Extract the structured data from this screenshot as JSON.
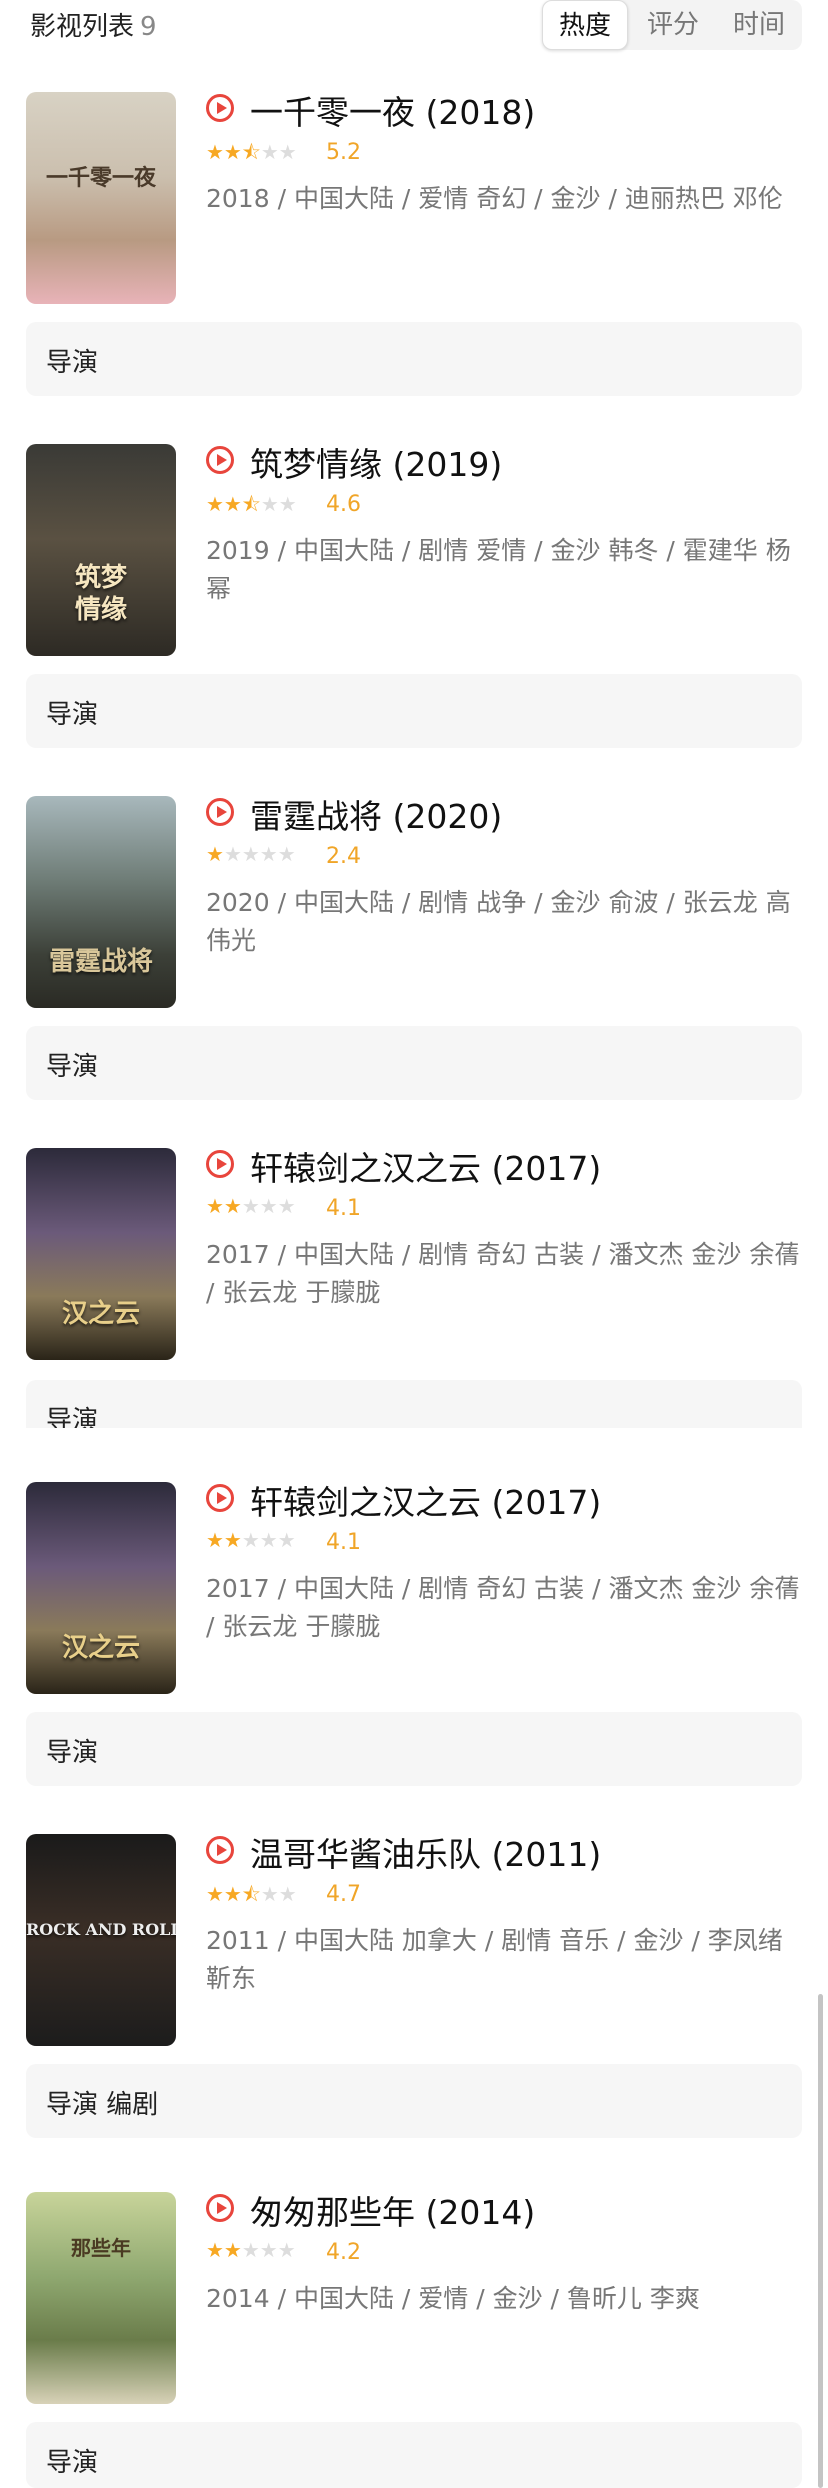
{
  "header": {
    "title": "影视列表",
    "count": "9",
    "sort_tabs": [
      "热度",
      "评分",
      "时间"
    ]
  },
  "colors": {
    "accent": "#e8453c",
    "star": "#f7a823",
    "rating": "#f0a528"
  },
  "movies": [
    {
      "title": "一千零一夜 (2018)",
      "rating": "5.2",
      "stars": 2.5,
      "meta": "2018 / 中国大陆 / 爱情 奇幻 / 金沙 / 迪丽热巴 邓伦",
      "credit": "导演",
      "poster_caption": "一千零一夜"
    },
    {
      "title": "筑梦情缘 (2019)",
      "rating": "4.6",
      "stars": 2.5,
      "meta": "2019 / 中国大陆 / 剧情 爱情 / 金沙 韩冬 / 霍建华 杨幂",
      "credit": "导演",
      "poster_caption": "筑梦\n情缘"
    },
    {
      "title": "雷霆战将 (2020)",
      "rating": "2.4",
      "stars": 1,
      "meta": "2020 / 中国大陆 / 剧情 战争 / 金沙 俞波 / 张云龙 高伟光",
      "credit": "导演",
      "poster_caption": "雷霆战将"
    },
    {
      "title": "轩辕剑之汉之云 (2017)",
      "rating": "4.1",
      "stars": 2,
      "meta": "2017 / 中国大陆 / 剧情 奇幻 古装 / 潘文杰 金沙 余蒨 / 张云龙 于朦胧",
      "credit": "导演",
      "poster_caption": "汉之云"
    },
    {
      "title": "轩辕剑之汉之云 (2017)",
      "rating": "4.1",
      "stars": 2,
      "meta": "2017 / 中国大陆 / 剧情 奇幻 古装 / 潘文杰 金沙 余蒨 / 张云龙 于朦胧",
      "credit": "导演",
      "poster_caption": "汉之云"
    },
    {
      "title": "温哥华酱油乐队 (2011)",
      "rating": "4.7",
      "stars": 2.5,
      "meta": "2011 / 中国大陆 加拿大 / 剧情 音乐 / 金沙 / 李凤绪 靳东",
      "credit": "导演 编剧",
      "poster_caption": "ROCK AND ROLL"
    },
    {
      "title": "匆匆那些年 (2014)",
      "rating": "4.2",
      "stars": 2,
      "meta": "2014 / 中国大陆 / 爱情 / 金沙 / 鲁昕儿 李爽",
      "credit": "导演",
      "poster_caption": "那些年"
    }
  ]
}
